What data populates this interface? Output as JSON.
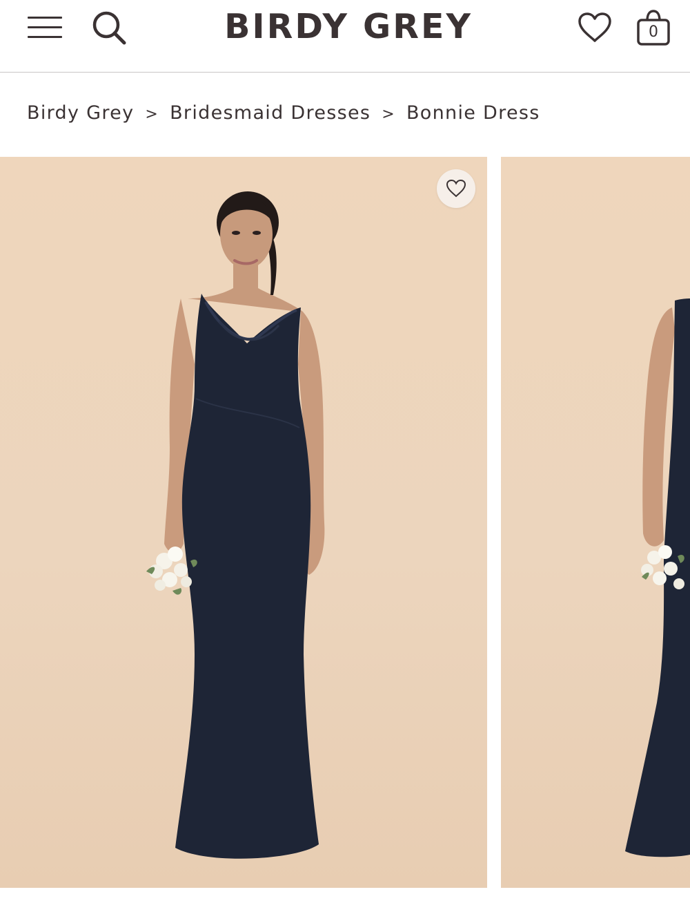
{
  "header": {
    "brand": "BIRDY GREY",
    "cart_count": "0",
    "icons": [
      "menu-icon",
      "search-icon",
      "heart-icon",
      "shopping-bag-icon"
    ]
  },
  "breadcrumb": {
    "items": [
      "Birdy Grey",
      "Bridesmaid Dresses",
      "Bonnie Dress"
    ],
    "separator": ">"
  },
  "gallery": {
    "images": [
      "product-image-front",
      "product-image-side"
    ],
    "favorite_icon": "heart-icon"
  },
  "colors": {
    "text": "#3a3233",
    "backdrop": "#ecd5bd",
    "dress": "#1e2536",
    "divider": "#c9c5c5"
  }
}
